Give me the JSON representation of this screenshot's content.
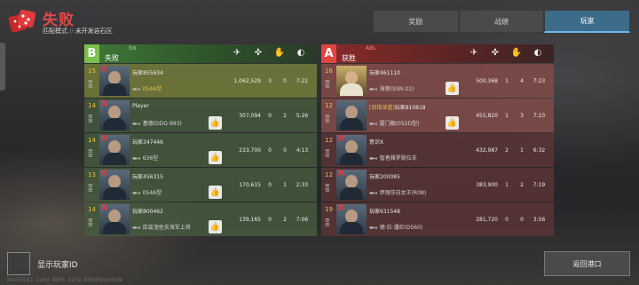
{
  "header": {
    "result_title": "失败",
    "mode": "匹配模式",
    "separator": "//",
    "map": "未开发岩石区",
    "result_icon": "red-dice-icon"
  },
  "tabs": [
    {
      "label": "奖励",
      "active": false
    },
    {
      "label": "战绩",
      "active": false
    },
    {
      "label": "玩家",
      "active": true
    }
  ],
  "stat_icons": [
    "ship-sink-icon",
    "crosshair-icon",
    "handshake-icon",
    "clock-icon"
  ],
  "team_b": {
    "letter": "B",
    "tag": "BN",
    "outcome": "失败",
    "color": "#7bc04a",
    "players": [
      {
        "rank": "15",
        "name": "玩家855634",
        "title": "",
        "ship": "054A型",
        "ship_highlight": true,
        "score": "1,062,529",
        "kills": "3",
        "assists": "0",
        "time": "7:22",
        "highlight": true,
        "liked": false
      },
      {
        "rank": "14",
        "name": "Player",
        "title": "",
        "ship": "基德(DDG-993)",
        "ship_highlight": false,
        "score": "307,094",
        "kills": "0",
        "assists": "2",
        "time": "5:26",
        "highlight": false,
        "liked": true
      },
      {
        "rank": "14",
        "name": "玩家347446",
        "title": "",
        "ship": "636型",
        "ship_highlight": false,
        "score": "233,700",
        "kills": "0",
        "assists": "0",
        "time": "4:13",
        "highlight": false,
        "liked": true
      },
      {
        "rank": "13",
        "name": "玩家456315",
        "title": "",
        "ship": "054A型",
        "ship_highlight": false,
        "score": "170,615",
        "kills": "0",
        "assists": "1",
        "time": "2:33",
        "highlight": false,
        "liked": true
      },
      {
        "rank": "14",
        "name": "玩家800462",
        "title": "",
        "ship": "库兹涅佐夫海军上将",
        "ship_highlight": false,
        "score": "139,165",
        "kills": "0",
        "assists": "2",
        "time": "7:06",
        "highlight": false,
        "liked": true
      }
    ]
  },
  "team_a": {
    "letter": "A",
    "tag": "ABL",
    "outcome": "获胜",
    "color": "#e0463f",
    "players": [
      {
        "rank": "16",
        "name": "玩家461110",
        "title": "",
        "ship": "海狼(SSN-21)",
        "ship_highlight": false,
        "score": "500,368",
        "kills": "1",
        "assists": "4",
        "time": "7:23",
        "highlight": true,
        "liked": true
      },
      {
        "rank": "12",
        "name": "玩家810818",
        "title": "[剑指深蓝]",
        "ship": "厦门舰(052D型)",
        "ship_highlight": false,
        "score": "455,820",
        "kills": "1",
        "assists": "3",
        "time": "7:23",
        "highlight": true,
        "liked": true
      },
      {
        "rank": "12",
        "name": "意识X",
        "title": "",
        "ship": "智者雅罗斯拉夫",
        "ship_highlight": false,
        "score": "432,987",
        "kills": "2",
        "assists": "1",
        "time": "6:32",
        "highlight": false,
        "liked": false
      },
      {
        "rank": "12",
        "name": "玩家200085",
        "title": "",
        "ship": "伊丽莎白女王(R08)",
        "ship_highlight": false,
        "score": "383,900",
        "kills": "1",
        "assists": "2",
        "time": "7:19",
        "highlight": false,
        "liked": false
      },
      {
        "rank": "19",
        "name": "玩家631548",
        "title": "",
        "ship": "德·拉·潘尼(D560)",
        "ship_highlight": false,
        "score": "281,720",
        "kills": "0",
        "assists": "0",
        "time": "3:56",
        "highlight": false,
        "liked": false
      }
    ]
  },
  "footer": {
    "show_id_label": "显示玩家ID",
    "back_label": "返回港口",
    "session_id": "8ea55c93-1a6d-4b05-9a7e-889d08dadbde"
  }
}
